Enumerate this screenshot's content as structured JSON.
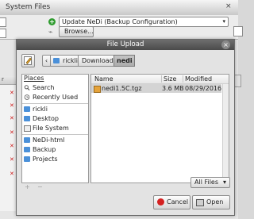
{
  "app": {
    "section_title": "System Files",
    "collapse_icon": "close-icon",
    "action_select": "Update NeDi (Backup Configuration)",
    "browse_label": "Browse...",
    "side_header": "r"
  },
  "dialog": {
    "title": "File Upload",
    "path": [
      "rickli",
      "Downloads",
      "nedi"
    ],
    "places": {
      "header": "Places",
      "items": [
        "Search",
        "Recently Used",
        "rickli",
        "Desktop",
        "File System",
        "NeDi-html",
        "Backup",
        "Projects"
      ]
    },
    "add_label": "+",
    "remove_label": "−",
    "columns": {
      "name": "Name",
      "size": "Size",
      "modified": "Modified"
    },
    "files": [
      {
        "name": "nedi1.5C.tgz",
        "size": "3.6 MB",
        "modified": "08/29/2016"
      }
    ],
    "filter": "All Files",
    "cancel_label": "Cancel",
    "open_label": "Open"
  },
  "colors": {
    "titlebar": "#4b4b4b",
    "folder": "#4a90d9",
    "cancel_icon": "#d42020",
    "add_icon": "#2e9b2e",
    "error_x": "#cc1b1b"
  }
}
